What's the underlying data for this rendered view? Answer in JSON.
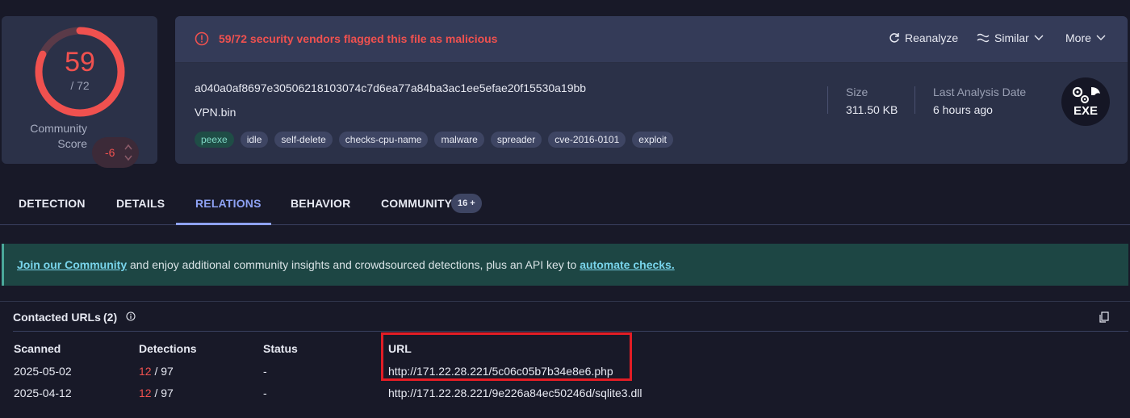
{
  "score": {
    "detected": "59",
    "total_label": "/ 72",
    "detected_fraction": 0.819,
    "community_label_1": "Community",
    "community_label_2": "Score",
    "community_value": "-6"
  },
  "alert": {
    "text": "59/72 security vendors flagged this file as malicious",
    "icon": "alert-circle-icon"
  },
  "actions": {
    "reanalyze": "Reanalyze",
    "similar": "Similar",
    "more": "More"
  },
  "file": {
    "hash": "a040a0af8697e30506218103074c7d6ea77a84ba3ac1ee5efae20f15530a19bb",
    "name": "VPN.bin",
    "tags": [
      "peexe",
      "idle",
      "self-delete",
      "checks-cpu-name",
      "malware",
      "spreader",
      "cve-2016-0101",
      "exploit"
    ],
    "size_label": "Size",
    "size_value": "311.50 KB",
    "last_analysis_label": "Last Analysis Date",
    "last_analysis_value": "6 hours ago",
    "type_icon_text": "EXE"
  },
  "tabs": [
    {
      "label": "DETECTION"
    },
    {
      "label": "DETAILS"
    },
    {
      "label": "RELATIONS"
    },
    {
      "label": "BEHAVIOR"
    },
    {
      "label": "COMMUNITY",
      "badge": "16 +"
    }
  ],
  "banner": {
    "link1": "Join our Community",
    "middle": " and enjoy additional community insights and crowdsourced detections, plus an API key to ",
    "link2": "automate checks."
  },
  "section": {
    "title": "Contacted URLs",
    "count": "(2)"
  },
  "table": {
    "headers": [
      "Scanned",
      "Detections",
      "Status",
      "URL"
    ],
    "rows": [
      {
        "scanned": "2025-05-02",
        "det": "12",
        "det_total": " / 97",
        "status": "-",
        "url": "http://171.22.28.221/5c06c05b7b34e8e6.php"
      },
      {
        "scanned": "2025-04-12",
        "det": "12",
        "det_total": " / 97",
        "status": "-",
        "url": "http://171.22.28.221/9e226a84ec50246d/sqlite3.dll"
      }
    ]
  },
  "colors": {
    "accent": "#8ea2f4",
    "danger": "#f0514f",
    "highlight": "#e21d25"
  }
}
